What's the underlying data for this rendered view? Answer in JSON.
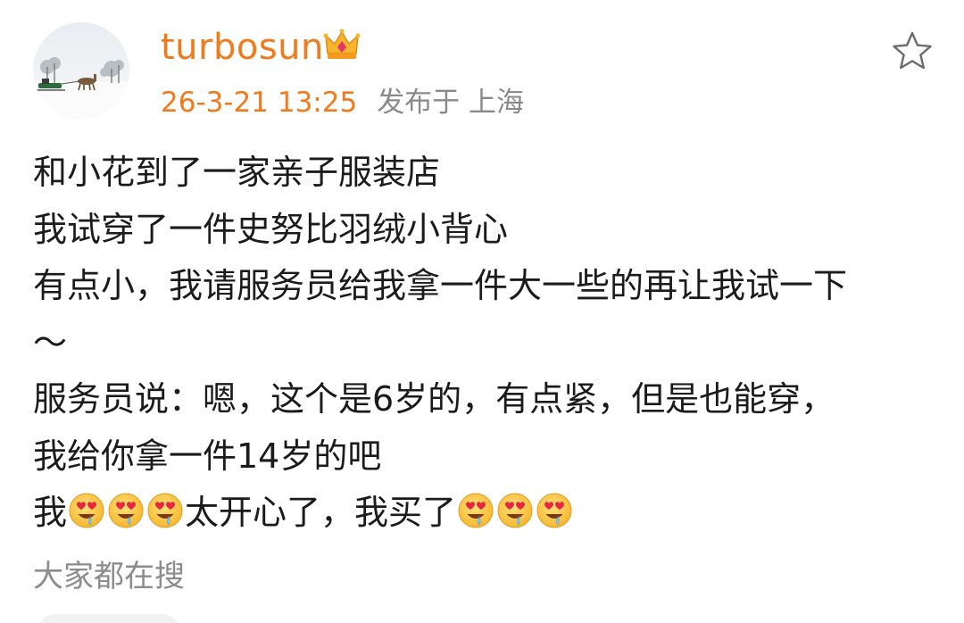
{
  "post": {
    "username": "turbosun",
    "badge_icon": "crown-badge-icon",
    "timestamp": "26-3-21 13:25",
    "location": "发布于 上海",
    "favorite_icon": "star-outline-icon",
    "lines": [
      "和小花到了一家亲子服装店",
      "我试穿了一件史努比羽绒小背心",
      "有点小，我请服务员给我拿一件大一些的再让我试一下",
      "～",
      "服务员说：嗯，这个是6岁的，有点紧，但是也能穿，",
      "我给你拿一件14岁的吧"
    ],
    "last_line": {
      "prefix": "我",
      "middle": "太开心了，我买了",
      "emoji_name": "heart-eyes-drooling-emoji"
    }
  },
  "search_hint": "大家都在搜",
  "colors": {
    "username": "#f07a1c",
    "timestamp": "#f07a1c",
    "location": "#8a8a8a",
    "body_text": "#1b1b1b",
    "hint": "#8c8c8c"
  }
}
